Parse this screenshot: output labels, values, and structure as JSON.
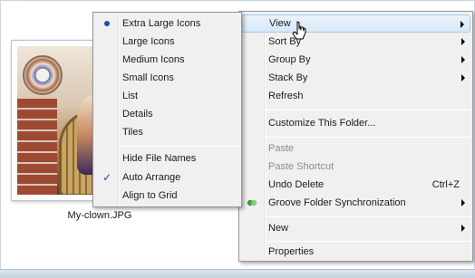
{
  "view_submenu": {
    "items": [
      {
        "label": "Extra Large Icons",
        "selected": true
      },
      {
        "label": "Large Icons"
      },
      {
        "label": "Medium Icons"
      },
      {
        "label": "Small Icons"
      },
      {
        "label": "List"
      },
      {
        "label": "Details"
      },
      {
        "label": "Tiles"
      }
    ],
    "options": [
      {
        "label": "Hide File Names"
      },
      {
        "label": "Auto Arrange",
        "checked": true
      },
      {
        "label": "Align to Grid"
      }
    ]
  },
  "context_menu": {
    "view": "View",
    "sort_by": "Sort By",
    "group_by": "Group By",
    "stack_by": "Stack By",
    "refresh": "Refresh",
    "customize": "Customize This Folder...",
    "paste": "Paste",
    "paste_shortcut": "Paste Shortcut",
    "undo_delete": "Undo Delete",
    "undo_delete_shortcut": "Ctrl+Z",
    "groove": "Groove Folder Synchronization",
    "new": "New",
    "properties": "Properties"
  },
  "file": {
    "name": "My-clown.JPG"
  },
  "colors": {
    "menu_bg": "#f0f0f0",
    "highlight": "#d9e8f8",
    "bullet": "#1e4fa5",
    "disabled_text": "#8d8d8d"
  }
}
